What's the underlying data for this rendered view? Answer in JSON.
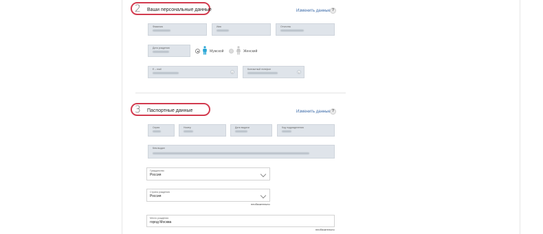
{
  "sections": [
    {
      "number": "2",
      "title": "Ваши персональные данные",
      "edit_label": "Изменить данные",
      "help_label": "?",
      "fields": {
        "surname_label": "Фамилия",
        "name_label": "Имя",
        "patronymic_label": "Отчество",
        "birthdate_label": "Дата рождения",
        "email_label": "E – mail",
        "phone_label": "Контактный телефон"
      },
      "gender": {
        "male_label": "Мужской",
        "female_label": "Женский",
        "selected": "Мужской"
      },
      "field_icon": "i"
    },
    {
      "number": "3",
      "title": "Паспортные данные",
      "edit_label": "Изменить данные",
      "help_label": "?",
      "fields": {
        "series_label": "Серия",
        "number_label": "Номер",
        "issue_date_label": "Дата выдачи",
        "division_code_label": "Код подразделения",
        "issued_by_label": "Кем выдан",
        "citizenship_label": "Гражданство",
        "citizenship_value": "Россия",
        "birth_country_label": "Страна рождения",
        "birth_country_value": "Россия",
        "birth_country_hint": "необязательно",
        "birth_place_label": "Место рождения",
        "birth_place_value": "город Москва",
        "birth_place_hint": "необязательно"
      }
    }
  ],
  "colors": {
    "accent_oval": "#d23a4e",
    "link": "#3b6aa8",
    "person_selected": "#29a6d6",
    "person_unselected": "#c8c8c8"
  },
  "icons": [
    "help-icon",
    "info-icon",
    "male-person-icon",
    "female-person-icon",
    "chevron-down-icon"
  ]
}
